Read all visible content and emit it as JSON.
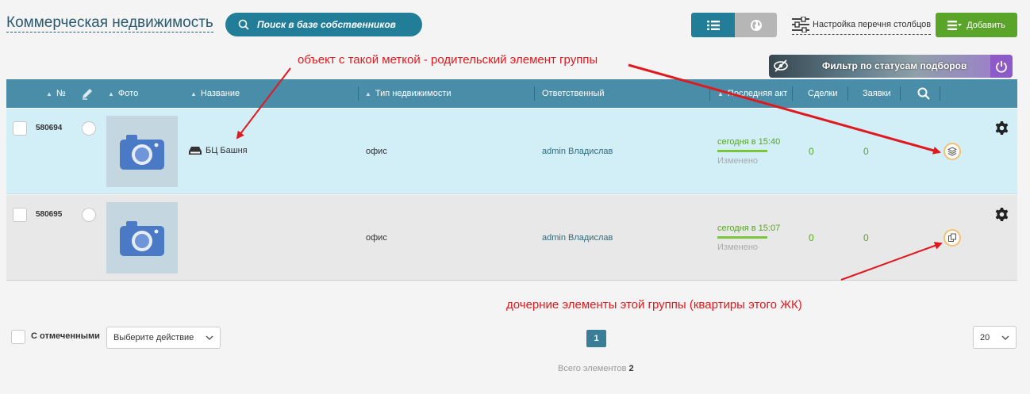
{
  "header": {
    "title": "Коммерческая недвижимость",
    "search_owners": "Поиск в базе собственников",
    "column_settings": "Настройка перечня столбцов",
    "add_button": "Добавить",
    "status_filter": "Фильтр по статусам подборов"
  },
  "annotations": {
    "parent": "объект с такой меткой - родительский элемент группы",
    "children": "дочерние элементы этой группы (квартиры этого ЖК)"
  },
  "table": {
    "columns": {
      "number": "№",
      "photo": "Фото",
      "name": "Название",
      "type": "Тип недвижимости",
      "responsible": "Ответственный",
      "last_activity": "Последняя акт",
      "deals": "Сделки",
      "requests": "Заявки"
    },
    "rows": [
      {
        "id": "580694",
        "name": "БЦ Башня",
        "type": "офис",
        "responsible": "admin Владислав",
        "activity_date": "сегодня в 15:40",
        "activity_status": "Изменено",
        "deals": "0",
        "requests": "0"
      },
      {
        "id": "580695",
        "name": "",
        "type": "офис",
        "responsible": "admin Владислав",
        "activity_date": "сегодня в 15:07",
        "activity_status": "Изменено",
        "deals": "0",
        "requests": "0"
      }
    ]
  },
  "footer": {
    "with_selected": "С отмеченными",
    "action_select": "Выберите действие",
    "current_page": "1",
    "total_label": "Всего элементов",
    "total_count": "2",
    "per_page": "20"
  },
  "colors": {
    "primary": "#227d99",
    "table_header": "#4a8da8",
    "add_green": "#5aa42a",
    "annotation_red": "#e0191f",
    "parent_row": "#d2eef7"
  }
}
